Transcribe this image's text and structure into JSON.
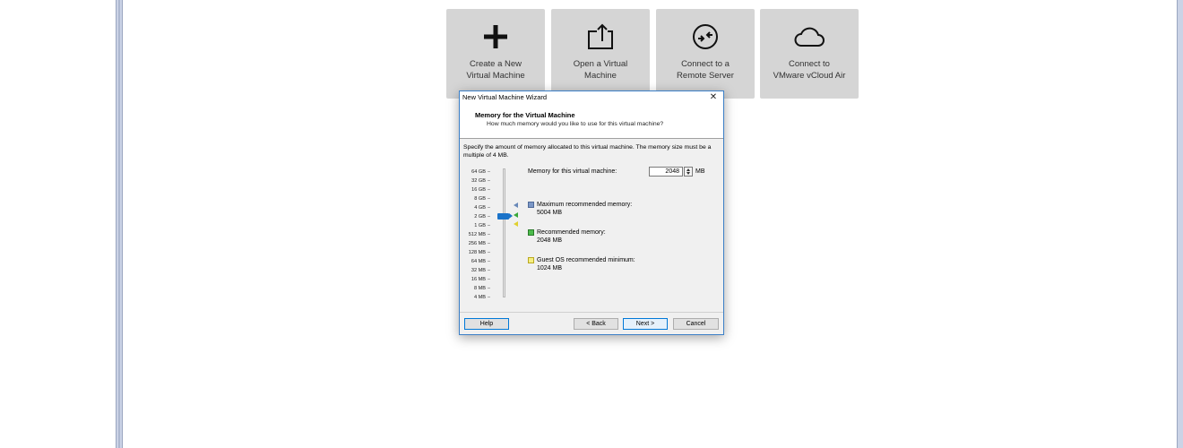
{
  "tiles": [
    {
      "label": "Create a New\nVirtual Machine",
      "icon": "plus-icon"
    },
    {
      "label": "Open a Virtual\nMachine",
      "icon": "open-export-icon"
    },
    {
      "label": "Connect to a\nRemote Server",
      "icon": "remote-server-icon"
    },
    {
      "label": "Connect to\nVMware vCloud Air",
      "icon": "cloud-icon"
    }
  ],
  "dialog": {
    "title": "New Virtual Machine Wizard",
    "close": "✕",
    "header_title": "Memory for the Virtual Machine",
    "header_subtitle": "How much memory would you like to use for this virtual machine?",
    "description": "Specify the amount of memory allocated to this virtual machine. The memory size must be a multiple of 4 MB.",
    "memory_label": "Memory for this virtual machine:",
    "memory_value": "2048",
    "memory_unit": "MB",
    "scale_ticks": [
      "64 GB",
      "32 GB",
      "16 GB",
      "8 GB",
      "4 GB",
      "2 GB",
      "1 GB",
      "512 MB",
      "256 MB",
      "128 MB",
      "64 MB",
      "32 MB",
      "16 MB",
      "8 MB",
      "4 MB"
    ],
    "slider_value": "2 GB",
    "legend": [
      {
        "label": "Maximum recommended memory:",
        "value": "5004 MB",
        "color": "#6888b8"
      },
      {
        "label": "Recommended memory:",
        "value": "2048 MB",
        "color": "#3aa83a"
      },
      {
        "label": "Guest OS recommended minimum:",
        "value": "1024 MB",
        "color": "#e0d030"
      }
    ],
    "buttons": {
      "help": "Help",
      "back": "< Back",
      "next": "Next >",
      "cancel": "Cancel"
    }
  }
}
